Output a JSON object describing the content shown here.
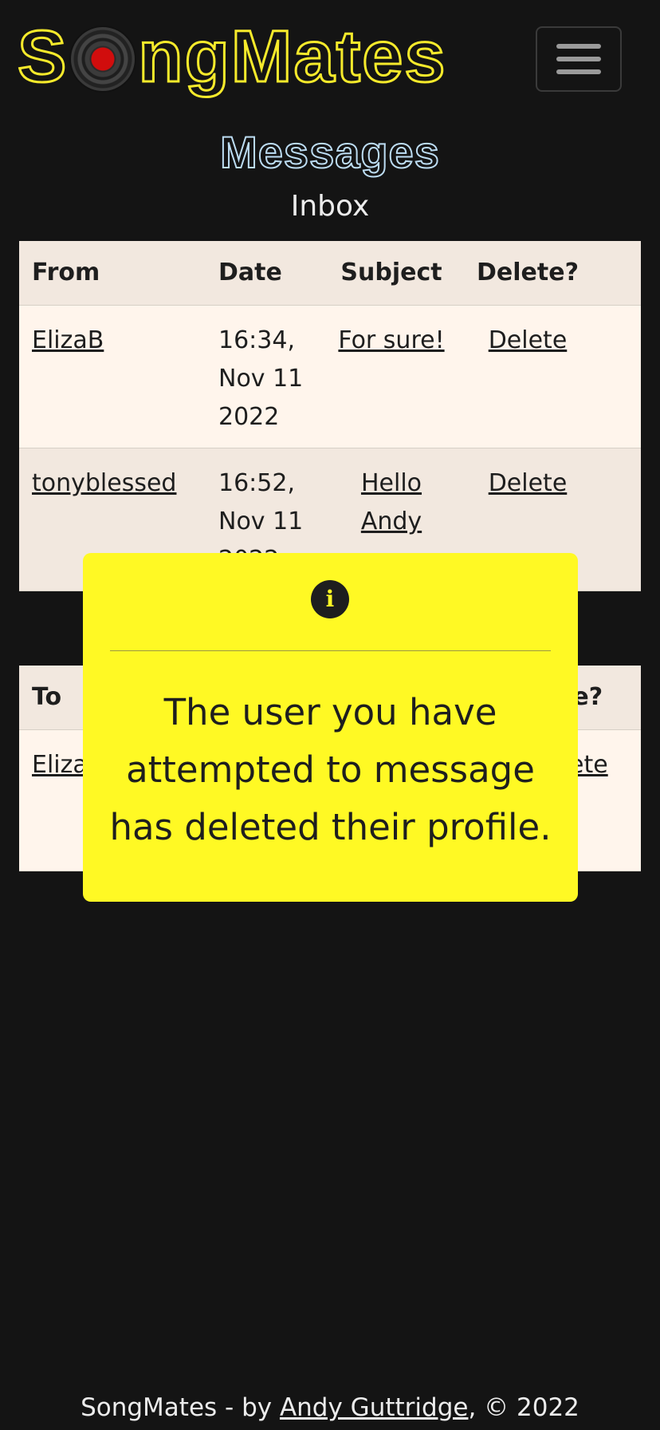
{
  "header": {
    "logo_part1": "S",
    "logo_part2": "ngMates",
    "menu_icon": "hamburger-icon"
  },
  "page": {
    "title": "Messages",
    "inbox_title": "Inbox"
  },
  "inbox": {
    "headers": [
      "From",
      "Date",
      "Subject",
      "Delete?"
    ],
    "rows": [
      {
        "from": "ElizaB",
        "date": "16:34, Nov 11 2022",
        "subject": "For sure!",
        "delete": "Delete"
      },
      {
        "from": "tonyblessed",
        "date": "16:52, Nov 11 2022",
        "subject": "Hello Andy",
        "delete": "Delete"
      }
    ]
  },
  "outbox": {
    "header_to": "To",
    "header_delete_partial": "te?",
    "row_to_partial": "Eliza",
    "row_delete_partial": "ete"
  },
  "modal": {
    "icon": "info-icon",
    "icon_glyph": "i",
    "message": "The user you have attempted to message has deleted their profile."
  },
  "footer": {
    "prefix": "SongMates - by ",
    "author": "Andy Guttridge",
    "suffix": ", © 2022"
  },
  "colors": {
    "background": "#141414",
    "logo_yellow": "#f6ea2b",
    "modal_yellow": "#fff924",
    "table_header": "#f2e8df",
    "table_row": "#fff5ec"
  }
}
